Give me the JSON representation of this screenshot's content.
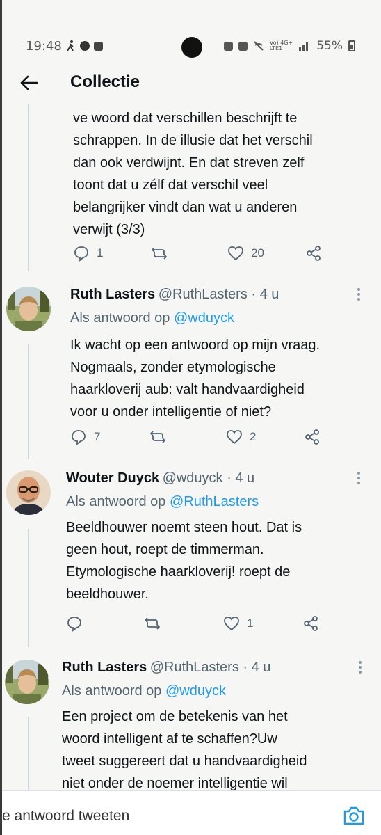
{
  "status_bar": {
    "time": "19:48",
    "network": "Vo) 4G+",
    "network_sub": "LTE1",
    "battery": "55%"
  },
  "header": {
    "title": "Collectie"
  },
  "tweets": [
    {
      "text_lines": [
        "ve woord dat verschillen beschrijft te",
        "schrappen. In de illusie dat het verschil",
        "dan ook verdwijnt. En dat streven zelf",
        "toont dat u zélf dat verschil veel",
        "belangrijker vindt dan wat u anderen",
        "verwijt (3/3)"
      ],
      "replies": "1",
      "likes": "20"
    },
    {
      "name": "Ruth Lasters",
      "handle": "@RuthLasters · 4 u",
      "reply_prefix": "Als antwoord op",
      "reply_to": "@wduyck",
      "text_lines": [
        "Ik wacht op een antwoord op mijn vraag.",
        "Nogmaals, zonder etymologische",
        "haarkloverij aub: valt handvaardigheid",
        "voor u onder intelligentie of niet?"
      ],
      "replies": "7",
      "likes": "2"
    },
    {
      "name": "Wouter Duyck",
      "handle": "@wduyck · 4 u",
      "reply_prefix": "Als antwoord op",
      "reply_to": "@RuthLasters",
      "text_lines": [
        "Beeldhouwer noemt steen hout. Dat is",
        "geen hout, roept de timmerman.",
        "Etymologische haarkloverij! roept de",
        "beeldhouwer."
      ],
      "replies": "",
      "likes": "1"
    },
    {
      "name": "Ruth Lasters",
      "handle": "@RuthLasters · 4 u",
      "reply_prefix": "Als antwoord op",
      "reply_to": "@wduyck",
      "text_lines": [
        "Een project om de betekenis van het",
        "woord intelligent af te schaffen?Uw",
        "tweet suggereert dat u handvaardigheid",
        "niet onder de noemer intelligentie wil"
      ]
    }
  ],
  "composer": {
    "placeholder": "e antwoord tweeten"
  },
  "colors": {
    "accent": "#1d9bf0",
    "text": "#0f1419",
    "muted": "#536471"
  },
  "icons": [
    "back-arrow-icon",
    "reply-icon",
    "retweet-icon",
    "like-icon",
    "share-icon",
    "more-icon",
    "camera-icon"
  ]
}
